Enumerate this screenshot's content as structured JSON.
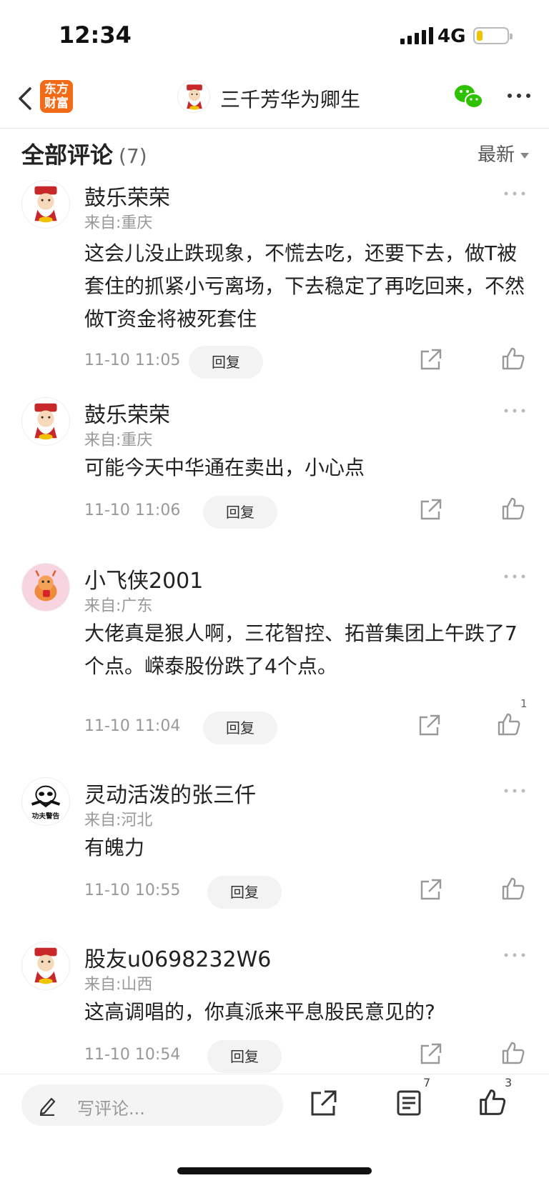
{
  "status_bar": {
    "time": "12:34",
    "network": "4G"
  },
  "nav": {
    "logo_line1": "东方",
    "logo_line2": "财富",
    "title": "三千芳华为卿生"
  },
  "section": {
    "title": "全部评论",
    "count": "(7)",
    "sort": "最新"
  },
  "comments": [
    {
      "name": "鼓乐荣荣",
      "origin": "来自:重庆",
      "text": "这会儿没止跌现象，不慌去吃，还要下去，做T被套住的抓紧小亏离场，下去稳定了再吃回来，不然做T资金将被死套住",
      "time": "11-10 11:05",
      "reply": "回复",
      "likes": "",
      "avatar": "caishen-avatar"
    },
    {
      "name": "鼓乐荣荣",
      "origin": "来自:重庆",
      "text": "可能今天中华通在卖出，小心点",
      "time": "11-10 11:06",
      "reply": "回复",
      "likes": "",
      "avatar": "caishen-avatar"
    },
    {
      "name": "小飞侠2001",
      "origin": "来自:广东",
      "text": "大佬真是狠人啊，三花智控、拓普集团上午跌了7个点。嵘泰股份跌了4个点。",
      "time": "11-10 11:04",
      "reply": "回复",
      "likes": "1",
      "avatar": "dragon-avatar"
    },
    {
      "name": "灵动活泼的张三仟",
      "origin": "来自:河北",
      "text": "有魄力",
      "time": "11-10 10:55",
      "reply": "回复",
      "likes": "",
      "avatar": "panda-avatar",
      "avatar_text": "功夫警告"
    },
    {
      "name": "股友u0698232W6",
      "origin": "来自:山西",
      "text": "这高调唱的，你真派来平息股民意见的?",
      "time": "11-10 10:54",
      "reply": "回复",
      "likes": "",
      "avatar": "caishen-avatar"
    }
  ],
  "bottom_bar": {
    "placeholder": "写评论...",
    "comments_count": "7",
    "likes_count": "3"
  },
  "colors": {
    "brand": "#f26a16",
    "wechat": "#2dc100",
    "battery": "#f2c200"
  }
}
